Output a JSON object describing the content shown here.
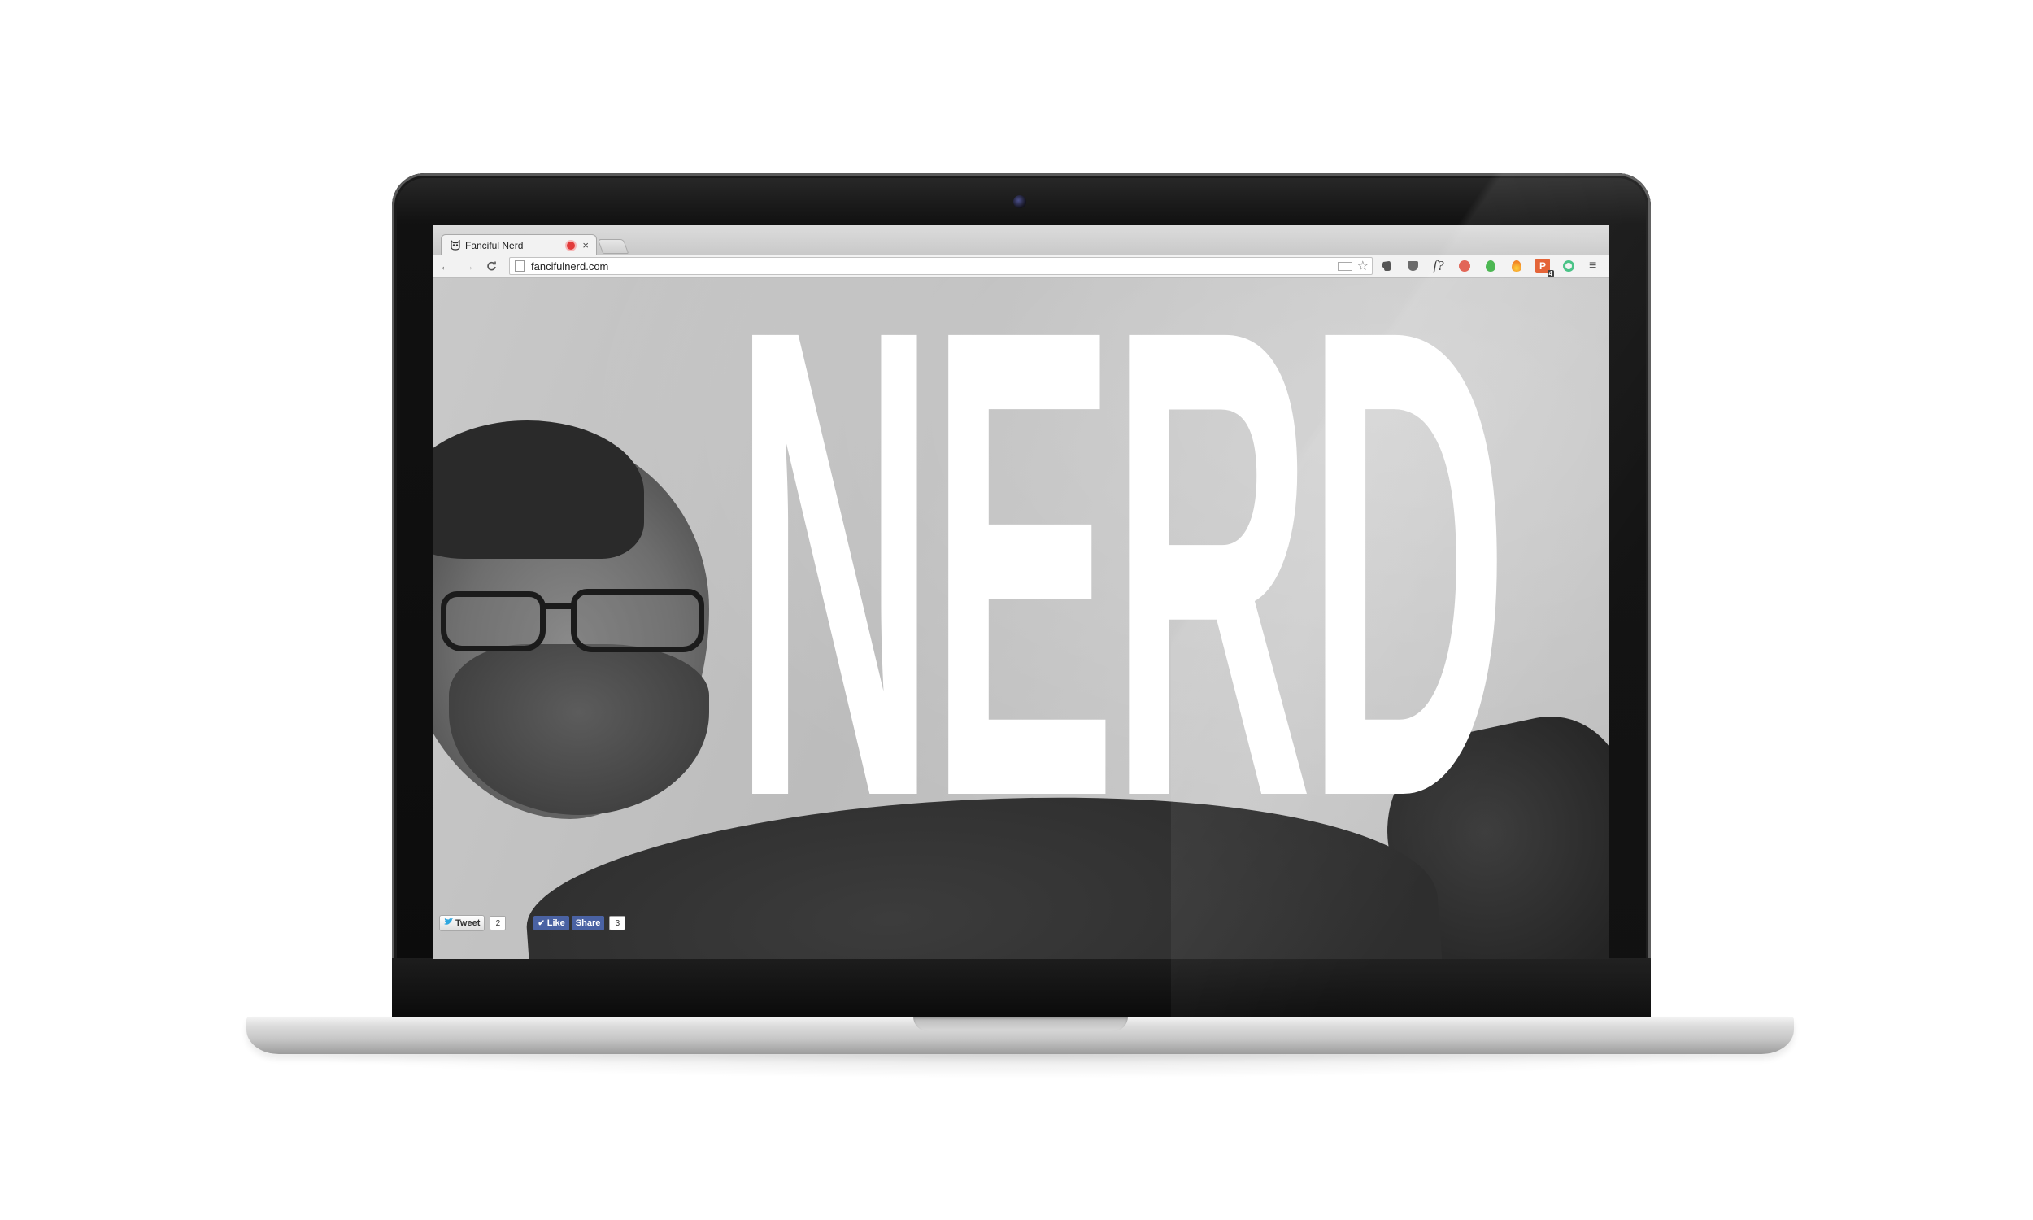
{
  "browser": {
    "tab_title": "Fanciful Nerd",
    "tab_close": "×",
    "url": "fancifulnerd.com",
    "menu_glyph": "≡",
    "nav_back": "←",
    "nav_forward": "→",
    "nav_reload": "C",
    "extensions": {
      "fonts_label": "f?",
      "badge_letter": "P",
      "badge_count": "4"
    }
  },
  "page": {
    "hero_word": "NERD"
  },
  "social": {
    "tweet_label": "Tweet",
    "tweet_count": "2",
    "like_label": "Like",
    "share_label": "Share",
    "share_count": "3"
  },
  "colors": {
    "recording_indicator": "#e23b3b",
    "facebook_blue": "#4a62a3",
    "twitter_blue": "#2ea7e0"
  }
}
